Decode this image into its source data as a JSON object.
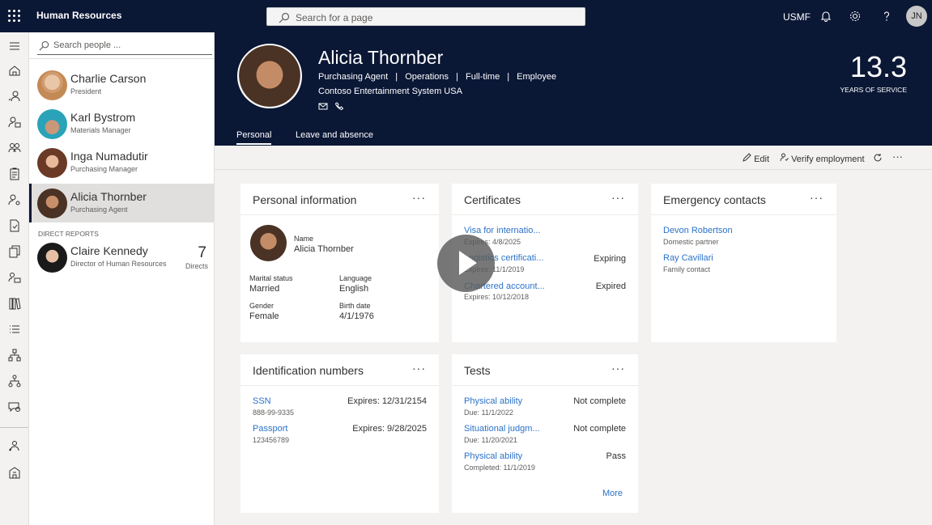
{
  "topbar": {
    "app_name": "Human Resources",
    "search_placeholder": "Search for a page",
    "company": "USMF",
    "user_initials": "JN",
    "icons": [
      "waffle-icon",
      "bell-icon",
      "gear-icon",
      "help-icon"
    ]
  },
  "people_panel": {
    "search_placeholder": "Search people ...",
    "people": [
      {
        "name": "Charlie Carson",
        "title": "President"
      },
      {
        "name": "Karl Bystrom",
        "title": "Materials Manager"
      },
      {
        "name": "Inga Numadutir",
        "title": "Purchasing Manager"
      },
      {
        "name": "Alicia Thornber",
        "title": "Purchasing Agent",
        "selected": true
      }
    ],
    "direct_reports_label": "DIRECT REPORTS",
    "direct_reports": [
      {
        "name": "Claire Kennedy",
        "title": "Director of Human Resources",
        "count": "7",
        "count_label": "Directs"
      }
    ]
  },
  "hero": {
    "name": "Alicia Thornber",
    "meta": [
      "Purchasing Agent",
      "|",
      "Operations",
      "|",
      "Full-time",
      "|",
      "Employee"
    ],
    "company": "Contoso Entertainment System USA",
    "years_value": "13.3",
    "years_label": "YEARS OF SERVICE",
    "tabs": [
      "Personal",
      "Leave and absence"
    ]
  },
  "actions": {
    "edit": "Edit",
    "verify": "Verify employment",
    "more": "···"
  },
  "personal_info": {
    "title": "Personal information",
    "name_label": "Name",
    "name_value": "Alicia Thornber",
    "marital_label": "Marital status",
    "marital_value": "Married",
    "language_label": "Language",
    "language_value": "English",
    "gender_label": "Gender",
    "gender_value": "Female",
    "birth_label": "Birth date",
    "birth_value": "4/1/1976"
  },
  "certificates": {
    "title": "Certificates",
    "items": [
      {
        "name": "Visa for internatio...",
        "expires": "Expires: 4/8/2025",
        "status": ""
      },
      {
        "name": "Logistics certificati...",
        "expires": "Expires: 11/1/2019",
        "status": "Expiring"
      },
      {
        "name": "Chartered account...",
        "expires": "Expires: 10/12/2018",
        "status": "Expired"
      }
    ]
  },
  "emergency": {
    "title": "Emergency contacts",
    "items": [
      {
        "name": "Devon Robertson",
        "relation": "Domestic partner"
      },
      {
        "name": "Ray Cavillari",
        "relation": "Family contact"
      }
    ]
  },
  "identification": {
    "title": "Identification numbers",
    "items": [
      {
        "name": "SSN",
        "number": "888-99-9335",
        "expires": "Expires: 12/31/2154"
      },
      {
        "name": "Passport",
        "number": "123456789",
        "expires": "Expires: 9/28/2025"
      }
    ]
  },
  "tests": {
    "title": "Tests",
    "items": [
      {
        "name": "Physical ability",
        "date": "Due: 11/1/2022",
        "status": "Not complete"
      },
      {
        "name": "Situational judgm...",
        "date": "Due: 11/20/2021",
        "status": "Not complete"
      },
      {
        "name": "Physical ability",
        "date": "Completed: 11/1/2019",
        "status": "Pass"
      }
    ],
    "more": "More"
  },
  "card_more": "···",
  "colors": {
    "nav_dark": "#0a1735",
    "link": "#2b72c9",
    "background": "#f3f2f1"
  }
}
